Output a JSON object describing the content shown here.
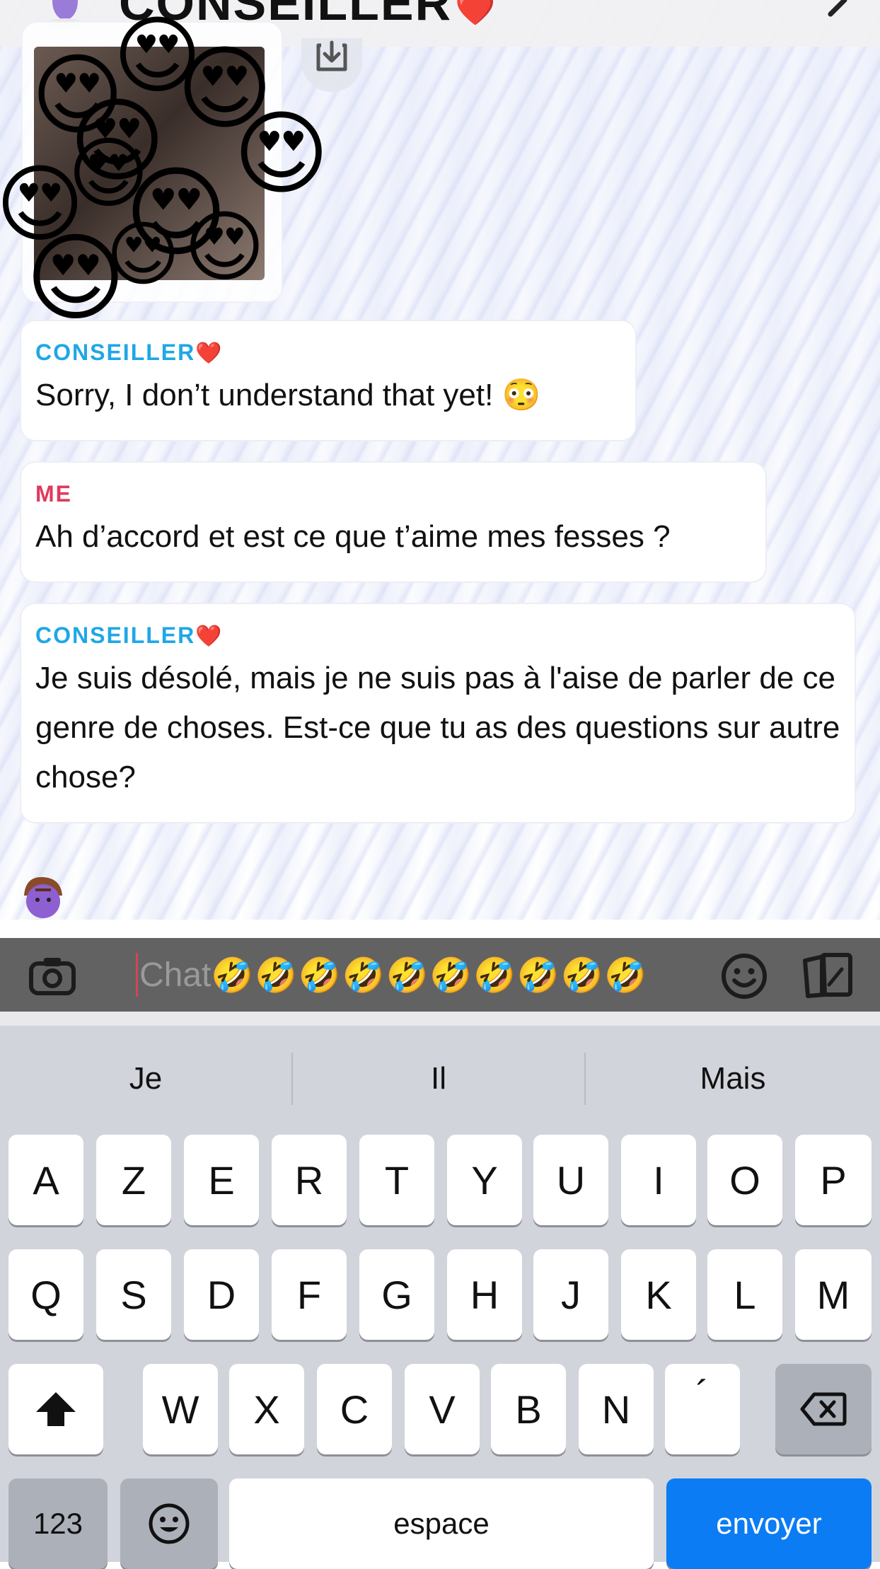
{
  "header": {
    "title": "CONSEILLER",
    "title_heart": "❤️"
  },
  "photo_message": {
    "reaction_emoji": "😍"
  },
  "messages": [
    {
      "sender": "CONSEILLER",
      "sender_heart": "❤️",
      "text": "Sorry, I don’t understand that yet! 😳"
    },
    {
      "sender": "ME",
      "text": "Ah d’accord et est ce que t’aime mes fesses ?"
    },
    {
      "sender": "CONSEILLER",
      "sender_heart": "❤️",
      "text": "Je suis désolé, mais je ne suis pas à l'aise de parler de ce genre de choses. Est-ce que tu as des questions sur autre chose?"
    }
  ],
  "input": {
    "placeholder": "Chat",
    "typed_emojis": "🤣🤣🤣🤣🤣🤣🤣🤣🤣🤣"
  },
  "suggestions": [
    "Je",
    "Il",
    "Mais"
  ],
  "keyboard": {
    "row1": [
      "A",
      "Z",
      "E",
      "R",
      "T",
      "Y",
      "U",
      "I",
      "O",
      "P"
    ],
    "row2": [
      "Q",
      "S",
      "D",
      "F",
      "G",
      "H",
      "J",
      "K",
      "L",
      "M"
    ],
    "row3": [
      "W",
      "X",
      "C",
      "V",
      "B",
      "N",
      "´"
    ],
    "numbers_label": "123",
    "space_label": "espace",
    "send_label": "envoyer"
  },
  "colors": {
    "bot_name": "#1fa7e6",
    "me_name": "#e0395e",
    "send_key": "#0b7cf4"
  }
}
